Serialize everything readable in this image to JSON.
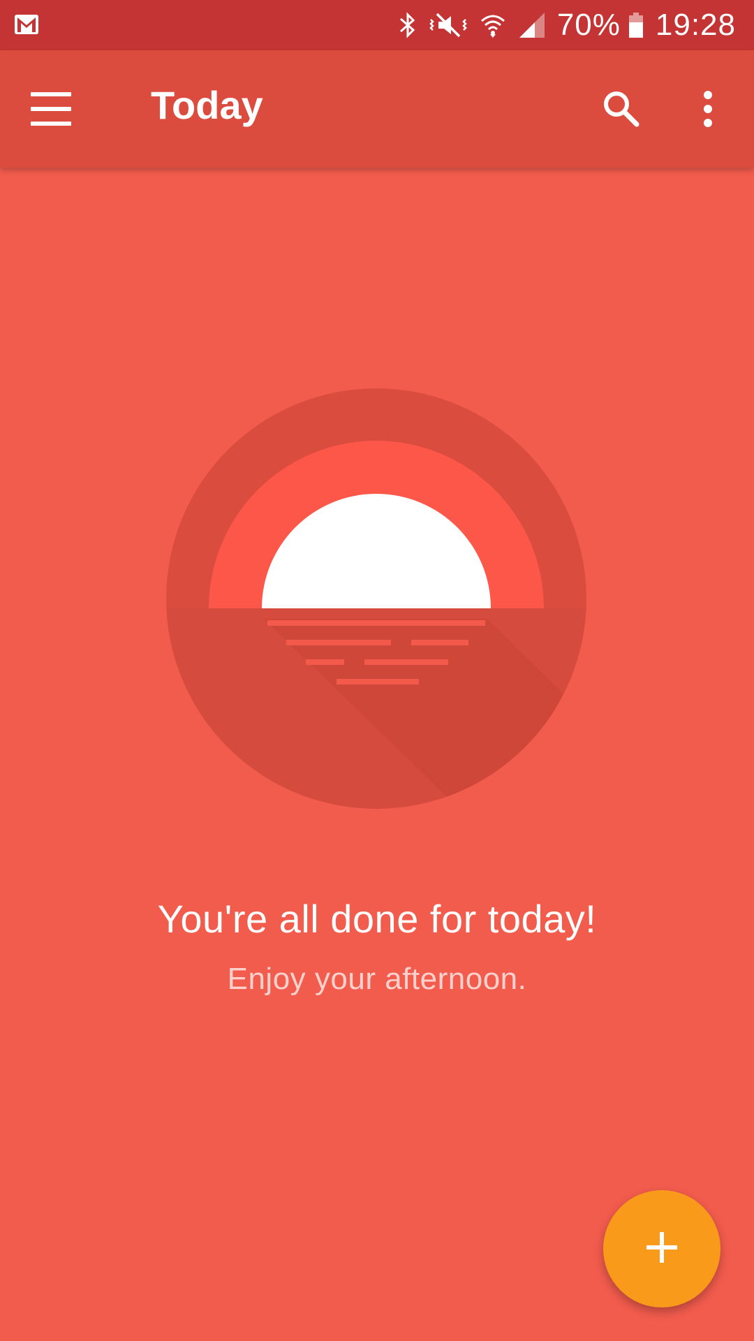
{
  "status_bar": {
    "battery_percent": "70%",
    "time": "19:28",
    "icons": [
      "gmail-icon",
      "bluetooth-icon",
      "vibrate-muted-icon",
      "wifi-icon",
      "cellular-signal-icon",
      "battery-icon"
    ]
  },
  "app_bar": {
    "title": "Today",
    "icons": [
      "hamburger-menu-icon",
      "search-icon",
      "more-vertical-icon"
    ]
  },
  "empty_state": {
    "illustration": "sunset-icon",
    "headline": "You're all done for today!",
    "subtitle": "Enjoy your afternoon."
  },
  "fab": {
    "icon": "plus-icon"
  },
  "colors": {
    "status_bar": "#C53434",
    "app_bar": "#DB4C3F",
    "background": "#F25C4D",
    "fab": "#F99A1A",
    "illustration_ring": "#DA4D3E",
    "illustration_inner": "#FC5749"
  }
}
